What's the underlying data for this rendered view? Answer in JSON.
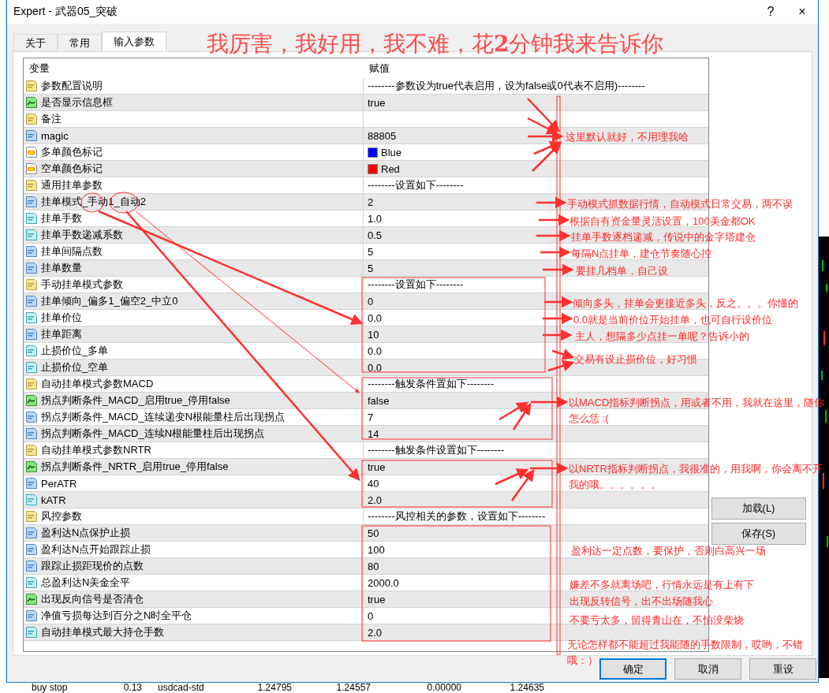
{
  "window": {
    "title": "Expert - 武器05_突破",
    "help": "?",
    "close": "×"
  },
  "tabs": [
    {
      "label": "关于",
      "selected": false
    },
    {
      "label": "常用",
      "selected": false
    },
    {
      "label": "输入参数",
      "selected": true
    }
  ],
  "table": {
    "columns": [
      "变量",
      "赋值"
    ],
    "rows": [
      {
        "kind": "string",
        "name": "参数配置说明",
        "value": "--------参数设为true代表启用，设为false或0代表不启用)--------"
      },
      {
        "kind": "bool",
        "name": "是否显示信息框",
        "value": "true"
      },
      {
        "kind": "string",
        "name": "备注"
      },
      {
        "kind": "int",
        "name": "magic",
        "value": "88805"
      },
      {
        "kind": "color",
        "name": "多单颜色标记",
        "value": "Blue",
        "color": "#0000ff"
      },
      {
        "kind": "color",
        "name": "空单颜色标记",
        "value": "Red",
        "color": "#ff0000"
      },
      {
        "kind": "string",
        "name": "通用挂单参数",
        "value": "--------设置如下--------"
      },
      {
        "kind": "int",
        "name": "挂单模式_手动1_自动2",
        "value": "2"
      },
      {
        "kind": "double",
        "name": "挂单手数",
        "value": "1.0"
      },
      {
        "kind": "double",
        "name": "挂单手数递减系数",
        "value": "0.5"
      },
      {
        "kind": "int",
        "name": "挂单间隔点数",
        "value": "5"
      },
      {
        "kind": "int",
        "name": "挂单数量",
        "value": "5"
      },
      {
        "kind": "string",
        "name": "手动挂单模式参数",
        "value": "--------设置如下--------"
      },
      {
        "kind": "int",
        "name": "挂单倾向_偏多1_偏空2_中立0",
        "value": "0"
      },
      {
        "kind": "double",
        "name": "挂单价位",
        "value": "0.0"
      },
      {
        "kind": "int",
        "name": "挂单距离",
        "value": "10"
      },
      {
        "kind": "double",
        "name": "止损价位_多单",
        "value": "0.0"
      },
      {
        "kind": "double",
        "name": "止损价位_空单",
        "value": "0.0"
      },
      {
        "kind": "string",
        "name": "自动挂单模式参数MACD",
        "value": "--------触发条件置如下--------"
      },
      {
        "kind": "bool",
        "name": "拐点判断条件_MACD_启用true_停用false",
        "value": "false"
      },
      {
        "kind": "int",
        "name": "拐点判断条件_MACD_连续递变N根能量柱后出现拐点",
        "value": "7"
      },
      {
        "kind": "int",
        "name": "拐点判断条件_MACD_连续N根能量柱后出现拐点",
        "value": "14"
      },
      {
        "kind": "string",
        "name": "自动挂单模式参数NRTR",
        "value": "--------触发条件设置如下--------"
      },
      {
        "kind": "bool",
        "name": "拐点判断条件_NRTR_启用true_停用false",
        "value": "true"
      },
      {
        "kind": "int",
        "name": "PerATR",
        "value": "40"
      },
      {
        "kind": "double",
        "name": "kATR",
        "value": "2.0"
      },
      {
        "kind": "string",
        "name": "风控参数",
        "value": "--------风控相关的参数，设置如下--------"
      },
      {
        "kind": "int",
        "name": "盈利达N点保护止损",
        "value": "50"
      },
      {
        "kind": "int",
        "name": "盈利达N点开始跟踪止损",
        "value": "100"
      },
      {
        "kind": "int",
        "name": "跟踪止损距现价的点数",
        "value": "80"
      },
      {
        "kind": "double",
        "name": "总盈利达N美金全平",
        "value": "2000.0"
      },
      {
        "kind": "bool",
        "name": "出现反向信号是否清仓",
        "value": "true"
      },
      {
        "kind": "int",
        "name": "净值亏损每达到百分之N时全平仓",
        "value": "0"
      },
      {
        "kind": "double",
        "name": "自动挂单模式最大持仓手数",
        "value": "2.0"
      }
    ]
  },
  "side_buttons": [
    "加载(L)",
    "保存(S)"
  ],
  "buttons": [
    {
      "label": "确定",
      "selected": true
    },
    {
      "label": "取消",
      "selected": false
    },
    {
      "label": "重设",
      "selected": false
    }
  ],
  "headline": "我厉害，我好用，我不难，花**2**分钟我来告诉你",
  "annotations": [
    "这里默认就好，不用理我哈",
    "手动模式抓数据行情，自动模式日常交易，两不误",
    "根据自有资金量灵活设置，100美金都OK",
    "挂单手数逐档递减，传说中的金字塔建仓",
    "每隔N点挂单，建仓节奏随心控",
    "要挂几档单，自己设",
    "倾向多头，挂单会更接近多头，反之。。。你懂的",
    "0.0就是当前价位开始挂单，也可自行设价位",
    "主人，想隔多少点挂一单呢？告诉小的",
    "交易有设止损价位，好习惯",
    "以MACD指标判断拐点，用或者不用，我就在这里，随你怎么恁 :(",
    "以NRTR指标判断拐点，我很准的，用我啊，你会离不开我的哦。。。。。。",
    "盈利达一定点数，要保护，否则白高兴一场",
    "嫌差不多就离场吧，行情永远是有上有下",
    "出现反转信号，出不出场随我心",
    "不要亏太多，留得青山在，不怕没柴烧",
    "无论怎样都不能超过我能随的手数限制，哎哟，不错哦：）"
  ],
  "background_orders": [
    "buy stop",
    "0.13",
    "usdcad-std",
    "1.24795",
    "1.24557",
    "0.00000",
    "1.24635"
  ]
}
